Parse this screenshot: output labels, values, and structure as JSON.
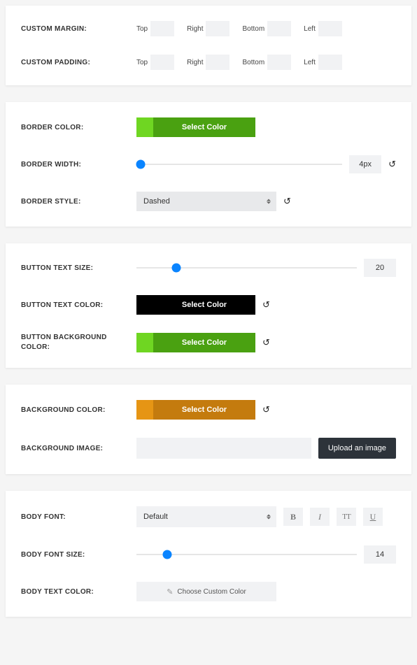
{
  "spacing": {
    "custom_margin_label": "CUSTOM MARGIN:",
    "custom_padding_label": "CUSTOM PADDING:",
    "dirs": {
      "top": "Top",
      "right": "Right",
      "bottom": "Bottom",
      "left": "Left"
    }
  },
  "border": {
    "color_label": "BORDER COLOR:",
    "color_btn": "Select Color",
    "width_label": "BORDER WIDTH:",
    "width_value": "4px",
    "style_label": "BORDER STYLE:",
    "style_value": "Dashed"
  },
  "button": {
    "text_size_label": "BUTTON TEXT SIZE:",
    "text_size_value": "20",
    "text_color_label": "BUTTON TEXT COLOR:",
    "text_color_btn": "Select Color",
    "bg_color_label": "BUTTON BACKGROUND COLOR:",
    "bg_color_btn": "Select Color"
  },
  "background": {
    "color_label": "BACKGROUND COLOR:",
    "color_btn": "Select Color",
    "image_label": "BACKGROUND IMAGE:",
    "upload_btn": "Upload an image"
  },
  "body": {
    "font_label": "BODY FONT:",
    "font_value": "Default",
    "styles": {
      "bold": "B",
      "italic": "I",
      "smallcaps": "TT",
      "underline": "U"
    },
    "font_size_label": "BODY FONT SIZE:",
    "font_size_value": "14",
    "text_color_label": "BODY TEXT COLOR:",
    "custom_color_btn": "Choose Custom Color"
  }
}
